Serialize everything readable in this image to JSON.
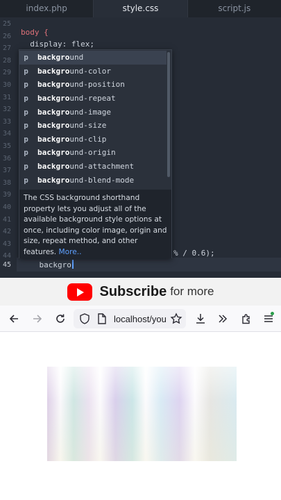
{
  "editor": {
    "tabs": [
      {
        "label": "index.php"
      },
      {
        "label": "style.css"
      },
      {
        "label": "script.js"
      }
    ],
    "active_tab": "style.css",
    "line_numbers": [
      "25",
      "26",
      "27",
      "28",
      "29",
      "30",
      "31",
      "32",
      "33",
      "34",
      "35",
      "36",
      "37",
      "38",
      "39",
      "40",
      "41",
      "42",
      "43",
      "44",
      "45"
    ],
    "code": {
      "selector": "body {",
      "display_line": "  display: flex;",
      "fragment_44": "% / 0.6);",
      "typed": "    backgro"
    }
  },
  "autocomplete": {
    "typed_prefix": "backgro",
    "items": [
      {
        "kind": "p",
        "rest": "und"
      },
      {
        "kind": "p",
        "rest": "und-color"
      },
      {
        "kind": "p",
        "rest": "und-position"
      },
      {
        "kind": "p",
        "rest": "und-repeat"
      },
      {
        "kind": "p",
        "rest": "und-image"
      },
      {
        "kind": "p",
        "rest": "und-size"
      },
      {
        "kind": "p",
        "rest": "und-clip"
      },
      {
        "kind": "p",
        "rest": "und-origin"
      },
      {
        "kind": "p",
        "rest": "und-attachment"
      },
      {
        "kind": "p",
        "rest": "und-blend-mode"
      }
    ],
    "description": "The CSS background shorthand property lets you adjust all of the available background style options at once, including color image, origin and size, repeat method, and other features.",
    "more_link": "More.."
  },
  "banner": {
    "main": "Subscribe",
    "rest": "for more"
  },
  "browser": {
    "url": "localhost/you",
    "icons": [
      "back-icon",
      "forward-icon",
      "reload-icon",
      "shield-icon",
      "page-icon",
      "star-icon",
      "download-icon",
      "more-tools-icon",
      "extensions-icon",
      "menu-icon"
    ]
  },
  "colors": {
    "editor_bg": "#262c36",
    "accent": "#5ea0ff",
    "selector": "#e0727a",
    "youtube_red": "#ff0000"
  }
}
